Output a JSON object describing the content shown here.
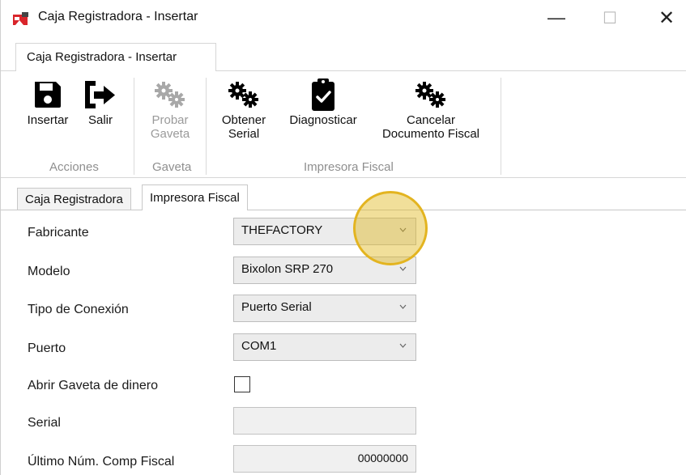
{
  "window": {
    "title": "Caja Registradora - Insertar",
    "minimize": "—",
    "maximize": "☐",
    "close": "✕"
  },
  "ribbon": {
    "tab_label": "Caja Registradora - Insertar",
    "buttons": [
      {
        "label": "Insertar",
        "icon": "save-icon",
        "enabled": true
      },
      {
        "label": "Salir",
        "icon": "exit-icon",
        "enabled": true
      },
      {
        "label_line1": "Probar",
        "label_line2": "Gaveta",
        "icon": "gears-icon",
        "enabled": false
      },
      {
        "label_line1": "Obtener",
        "label_line2": "Serial",
        "icon": "gears-icon",
        "enabled": true
      },
      {
        "label": "Diagnosticar",
        "icon": "clipboard-check-icon",
        "enabled": true
      },
      {
        "label_line1": "Cancelar",
        "label_line2": "Documento Fiscal",
        "icon": "gears-icon",
        "enabled": true
      }
    ],
    "groups": [
      "Acciones",
      "Gaveta",
      "Impresora Fiscal"
    ]
  },
  "tabs": [
    {
      "label": "Caja Registradora",
      "active": false
    },
    {
      "label": "Impresora Fiscal",
      "active": true
    }
  ],
  "form": {
    "fabricante_label": "Fabricante",
    "fabricante_value": "THEFACTORY",
    "modelo_label": "Modelo",
    "modelo_value": "Bixolon SRP 270",
    "conexion_label": "Tipo de Conexión",
    "conexion_value": "Puerto Serial",
    "puerto_label": "Puerto",
    "puerto_value": "COM1",
    "gaveta_label": "Abrir Gaveta de dinero",
    "gaveta_checked": false,
    "serial_label": "Serial",
    "serial_value": "",
    "ultimo_label": "Último Núm. Comp Fiscal",
    "ultimo_value": "00000000"
  },
  "colors": {
    "highlight": "#e3b420",
    "disabled_text": "#9a9a9a",
    "group_label": "#8f8f8f"
  }
}
